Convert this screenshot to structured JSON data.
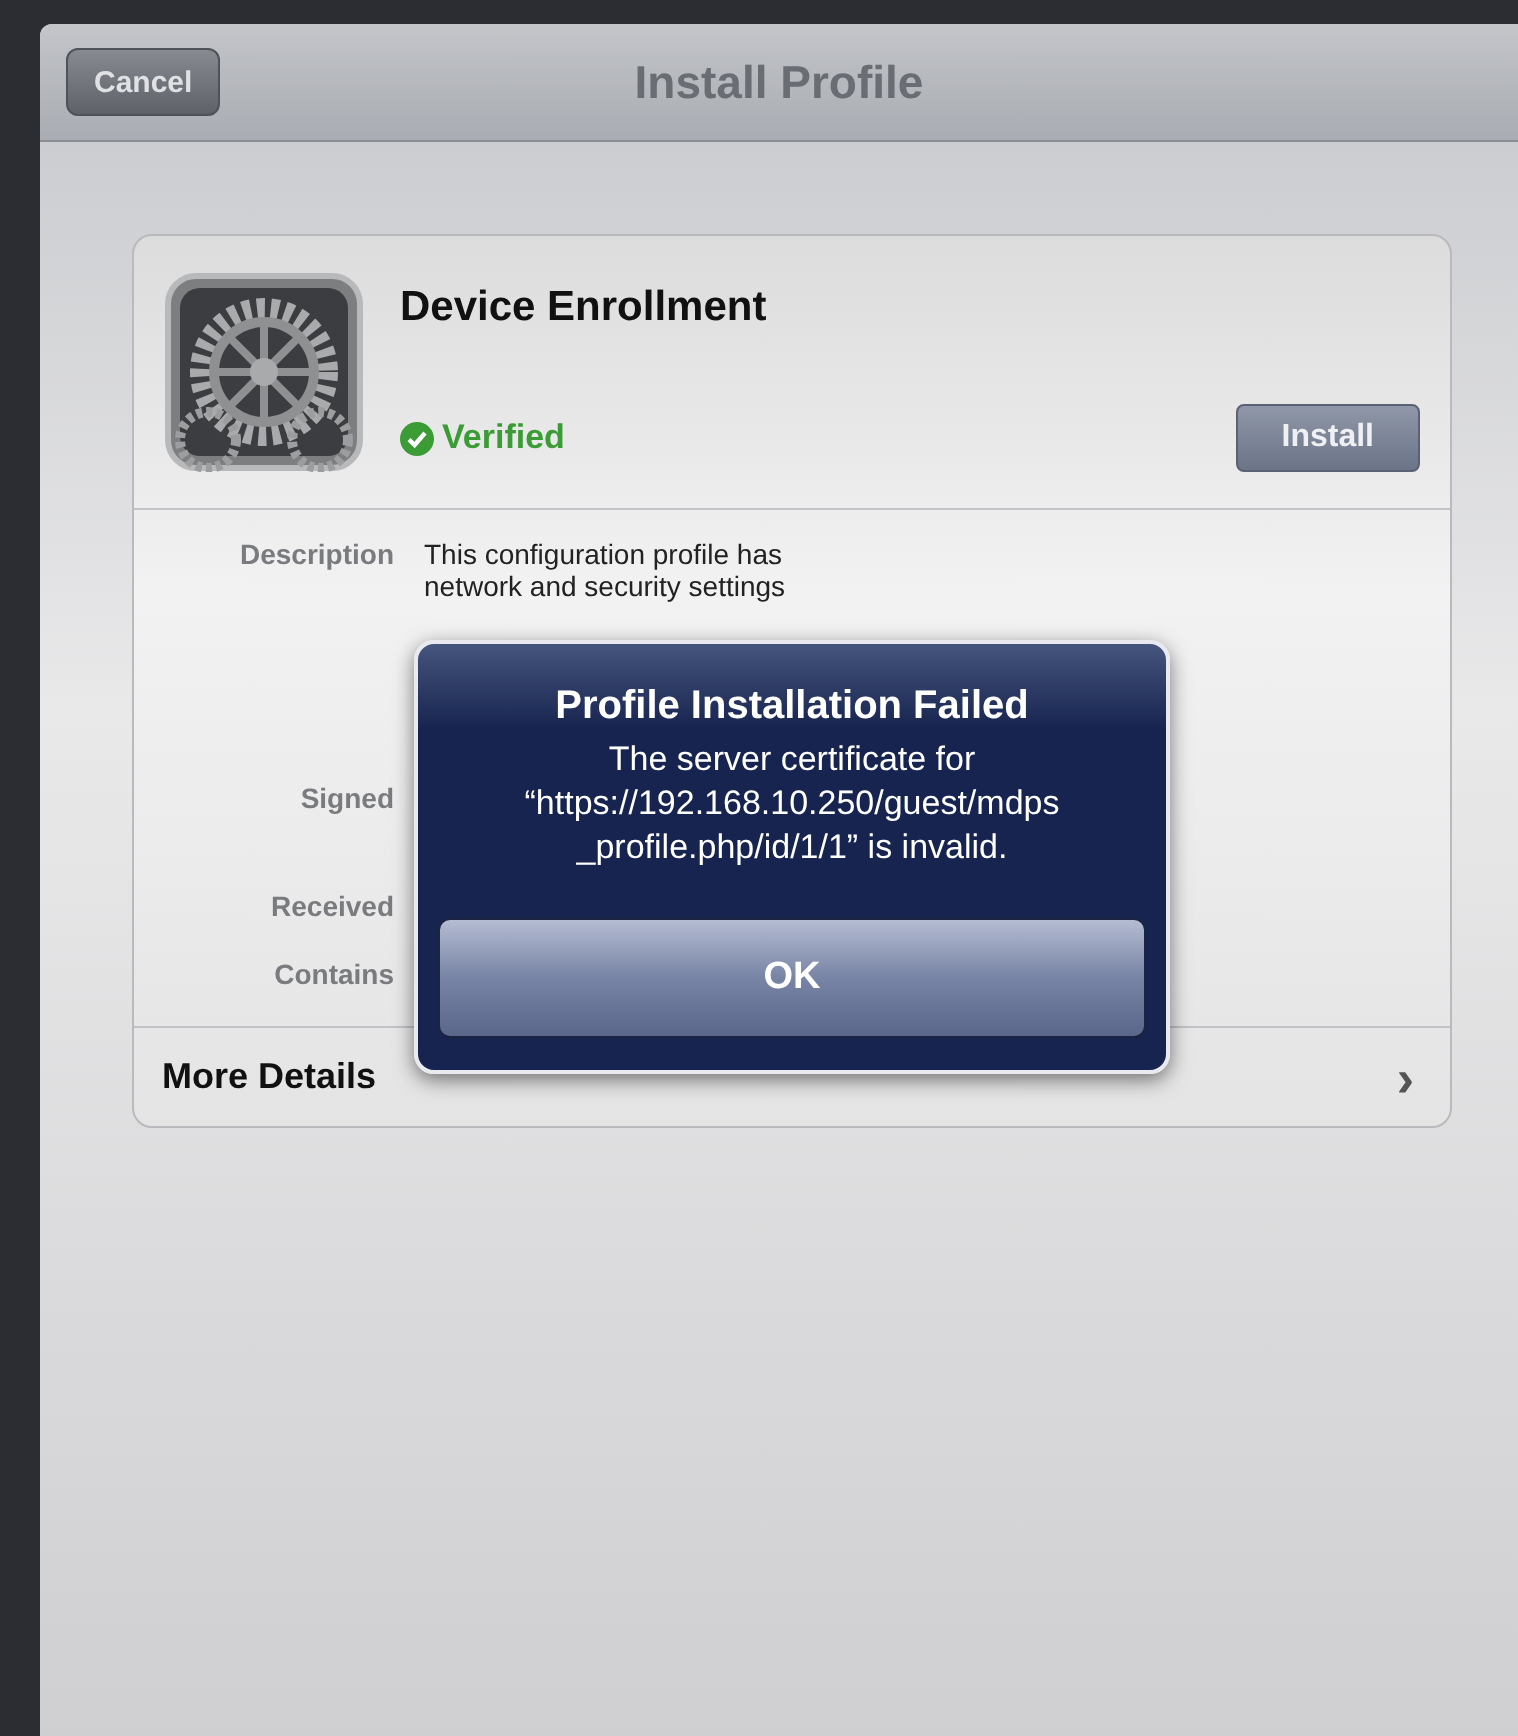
{
  "nav_bar": {
    "title": "Install Profile",
    "cancel_button": "Cancel"
  },
  "profile": {
    "name": "Device Enrollment",
    "verified": true,
    "verified_label": "Verified",
    "install_button": "Install"
  },
  "details": [
    {
      "label": "Description",
      "lines": [
        "This configuration profile has",
        "network and security settings"
      ]
    },
    {
      "label": "Signed"
    },
    {
      "label": "Received"
    },
    {
      "label": "Contains"
    }
  ],
  "more_details": {
    "label": "More Details",
    "chevron": "›"
  },
  "alert": {
    "title": "Profile Installation Failed",
    "message_lines": [
      "The server certificate for",
      "“https://192.168.10.250/guest/mdps",
      "_profile.php/id/1/1” is invalid."
    ],
    "button": "OK"
  }
}
